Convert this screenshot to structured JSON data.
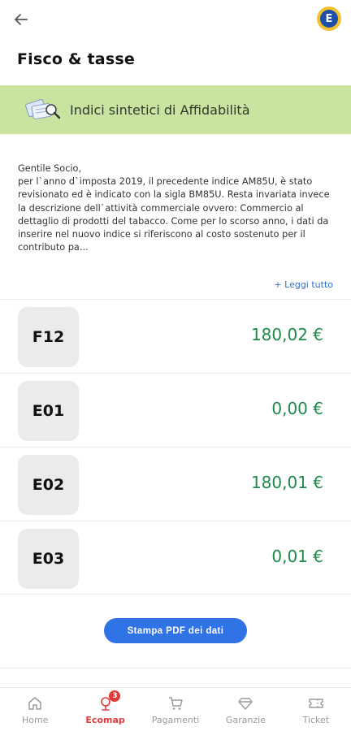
{
  "header": {
    "title": "Fisco & tasse",
    "avatar_letter": "E",
    "back_icon": "arrow-left-icon"
  },
  "banner": {
    "title": "Indici sintetici di Affidabilità",
    "icon": "documents-magnifier-icon",
    "background": "#c9e3a0"
  },
  "description": {
    "text": "Gentile Socio,\nper l`anno d`imposta 2019, il precedente indice AM85U, è stato revisionato ed è indicato con la sigla BM85U. Resta invariata invece la descrizione dell`attività commerciale ovvero: Commercio al dettaglio di prodotti del tabacco. Come per lo scorso anno, i dati da inserire nel nuovo indice si riferiscono al costo sostenuto per il contributo pa...",
    "read_more_label": "+ Leggi tutto"
  },
  "items": [
    {
      "code": "F12",
      "amount": "180,02 €"
    },
    {
      "code": "E01",
      "amount": "0,00 €"
    },
    {
      "code": "E02",
      "amount": "180,01 €"
    },
    {
      "code": "E03",
      "amount": "0,01 €"
    }
  ],
  "actions": {
    "print_pdf_label": "Stampa PDF dei dati"
  },
  "tabbar": {
    "tabs": [
      {
        "label": "Home",
        "icon": "home-icon"
      },
      {
        "label": "Ecomap",
        "icon": "map-pin-icon",
        "badge": "3",
        "active": true
      },
      {
        "label": "Pagamenti",
        "icon": "cart-icon"
      },
      {
        "label": "Garanzie",
        "icon": "diamond-icon"
      },
      {
        "label": "Ticket",
        "icon": "ticket-icon"
      }
    ]
  },
  "colors": {
    "accent_blue": "#2f73e6",
    "amount_green": "#1e8a4a",
    "active_red": "#e23a3a"
  }
}
